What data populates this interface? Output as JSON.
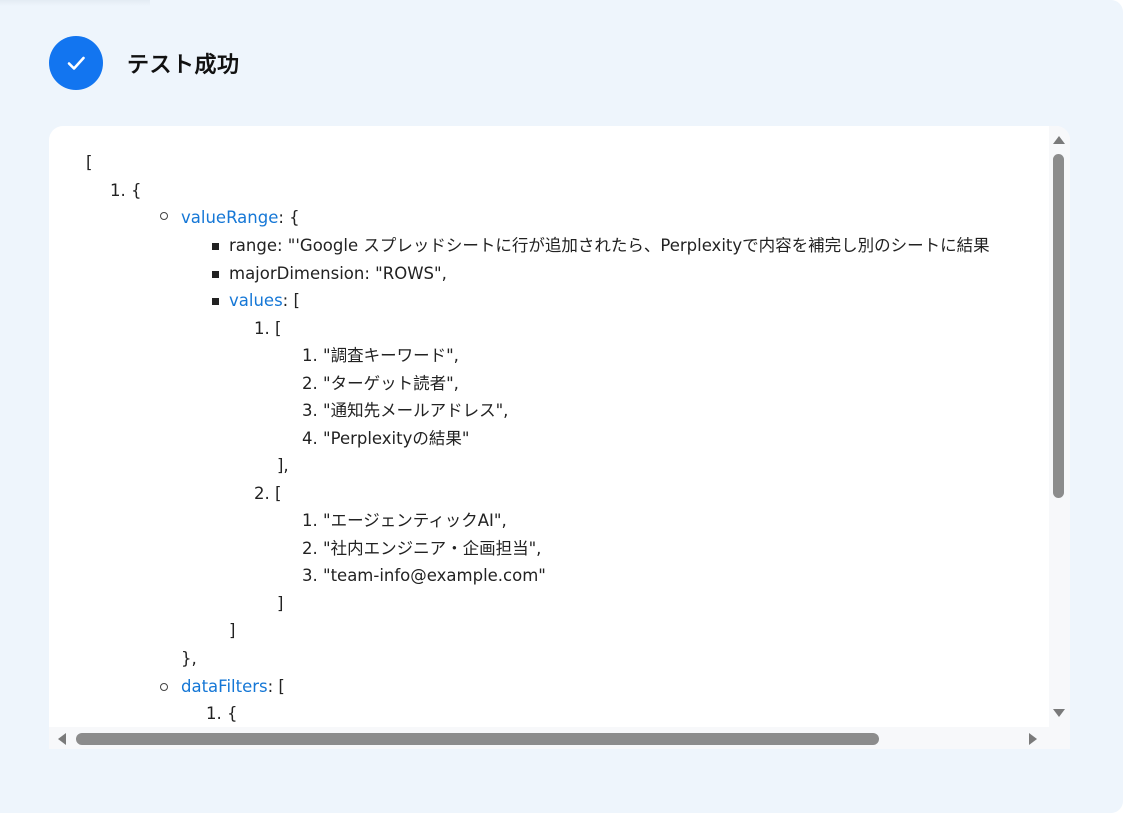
{
  "status": {
    "title": "テスト成功",
    "icon": "check-icon",
    "color": "#1275f0"
  },
  "json_view": {
    "open_bracket": "[",
    "item1_open": "1. {",
    "value_range_key": "valueRange",
    "value_range_open": ": {",
    "range_line": "range: \"'Google スプレッドシートに行が追加されたら、Perplexityで内容を補完し別のシートに結果",
    "major_dimension_line": "majorDimension: \"ROWS\",",
    "values_key": "values",
    "values_open": ": [",
    "row1_open": "1. [",
    "row1_items": [
      "1. \"調査キーワード\",",
      "2. \"ターゲット読者\",",
      "3. \"通知先メールアドレス\",",
      "4. \"Perplexityの結果\""
    ],
    "row1_close": "],",
    "row2_open": "2. [",
    "row2_items": [
      "1. \"エージェンティックAI\",",
      "2. \"社内エンジニア・企画担当\",",
      "3. \"team-info@example.com\""
    ],
    "row2_close": "]",
    "values_close": "]",
    "value_range_close": "},",
    "data_filters_key": "dataFilters",
    "data_filters_open": ": [",
    "filter1_open": "1. {"
  },
  "colors": {
    "page_background": "#eef5fc",
    "key_color": "#1577d6",
    "accent": "#1275f0"
  }
}
